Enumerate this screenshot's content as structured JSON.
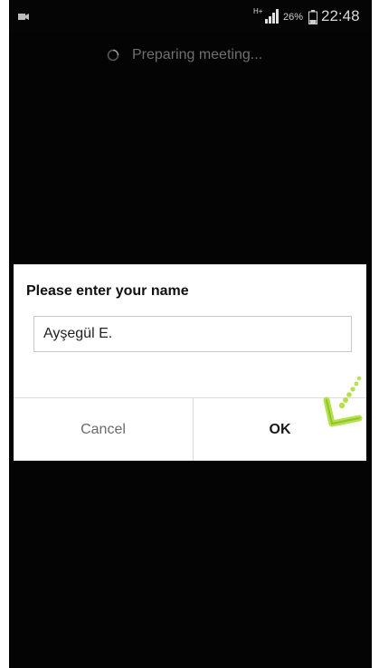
{
  "status_bar": {
    "network_type": "H+",
    "battery_percent": "26%",
    "time": "22:48",
    "icons": [
      "video-camera-icon",
      "signal-icon",
      "battery-icon"
    ]
  },
  "meeting": {
    "status_text": "Preparing meeting...",
    "spinner_icon": "spinner-icon"
  },
  "dialog": {
    "title": "Please enter your name",
    "name_value": "Ayşegül E.",
    "cancel_label": "Cancel",
    "ok_label": "OK",
    "tap_indicator_icon": "tap-gesture-icon"
  },
  "colors": {
    "screen_background": "#040404",
    "dialog_background": "#ffffff",
    "tap_indicator": "#b4e04a"
  }
}
